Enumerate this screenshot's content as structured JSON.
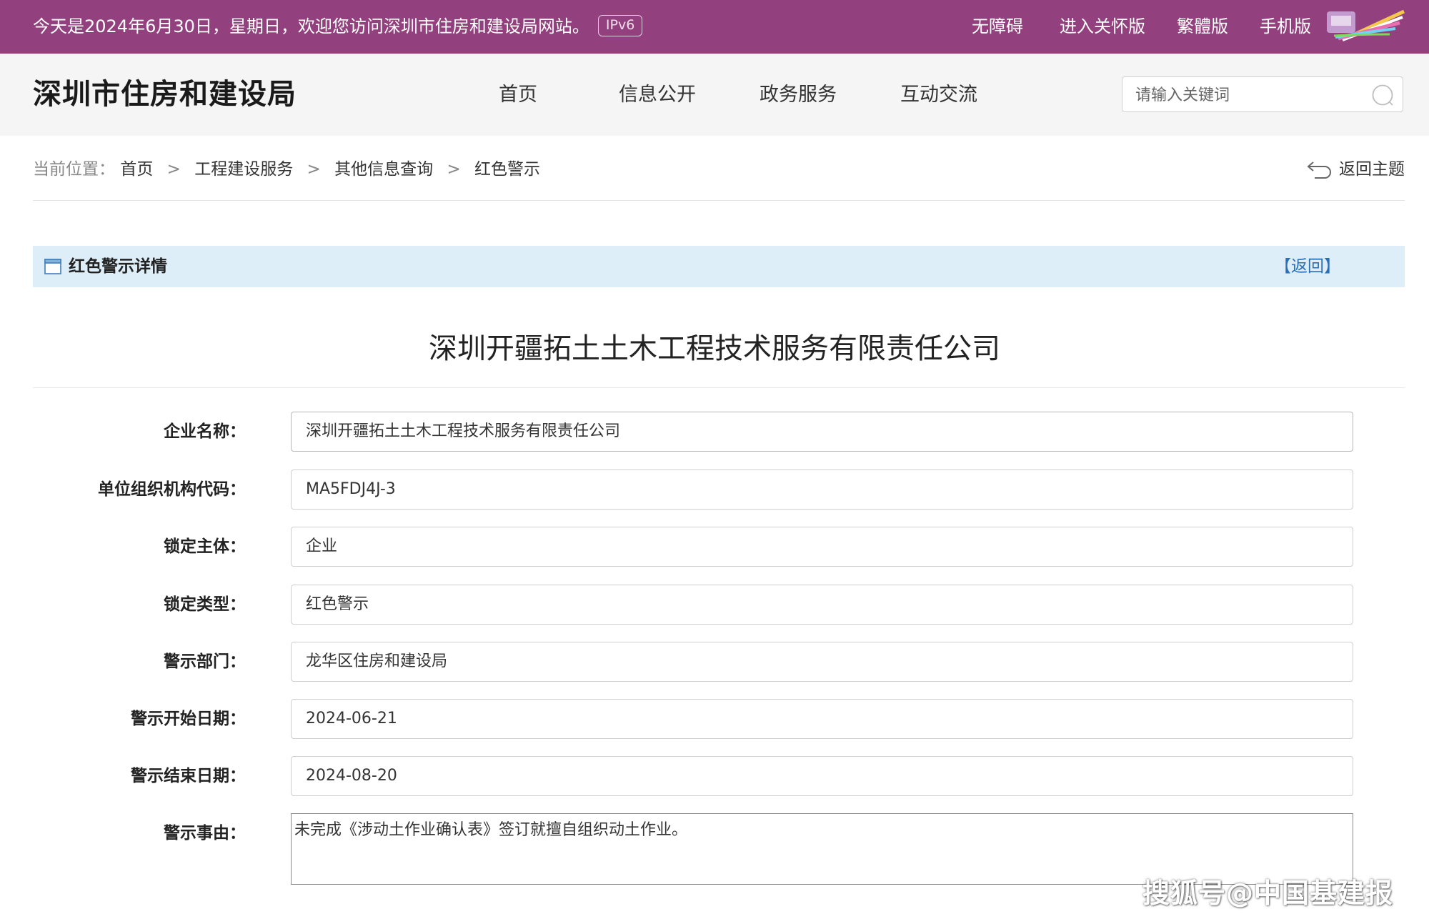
{
  "topbar": {
    "welcome": "今天是2024年6月30日，星期日，欢迎您访问深圳市住房和建设局网站。",
    "ipv6": "IPv6",
    "links": [
      "无障碍",
      "进入关怀版",
      "繁體版",
      "手机版"
    ],
    "accent_color": "#93407f"
  },
  "header": {
    "site_title": "深圳市住房和建设局",
    "nav": [
      "首页",
      "信息公开",
      "政务服务",
      "互动交流"
    ],
    "search_placeholder": "请输入关键词"
  },
  "breadcrumb": {
    "prefix": "当前位置：",
    "items": [
      "首页",
      "工程建设服务",
      "其他信息查询"
    ],
    "current": "红色警示",
    "separator": ">",
    "back_topic": "返回主题"
  },
  "panel": {
    "title": "红色警示详情",
    "back": "【返回】",
    "header_bg": "#ddeef8"
  },
  "company": {
    "heading": "深圳开疆拓土土木工程技术服务有限责任公司"
  },
  "form": [
    {
      "label": "企业名称：",
      "value": "深圳开疆拓土土木工程技术服务有限责任公司"
    },
    {
      "label": "单位组织机构代码：",
      "value": "MA5FDJ4J-3"
    },
    {
      "label": "锁定主体：",
      "value": "企业"
    },
    {
      "label": "锁定类型：",
      "value": "红色警示"
    },
    {
      "label": "警示部门：",
      "value": "龙华区住房和建设局"
    },
    {
      "label": "警示开始日期：",
      "value": "2024-06-21"
    },
    {
      "label": "警示结束日期：",
      "value": "2024-08-20"
    }
  ],
  "reason": {
    "label": "警示事由：",
    "value": "未完成《涉动土作业确认表》签订就擅自组织动土作业。"
  },
  "watermark": "搜狐号@中国基建报"
}
